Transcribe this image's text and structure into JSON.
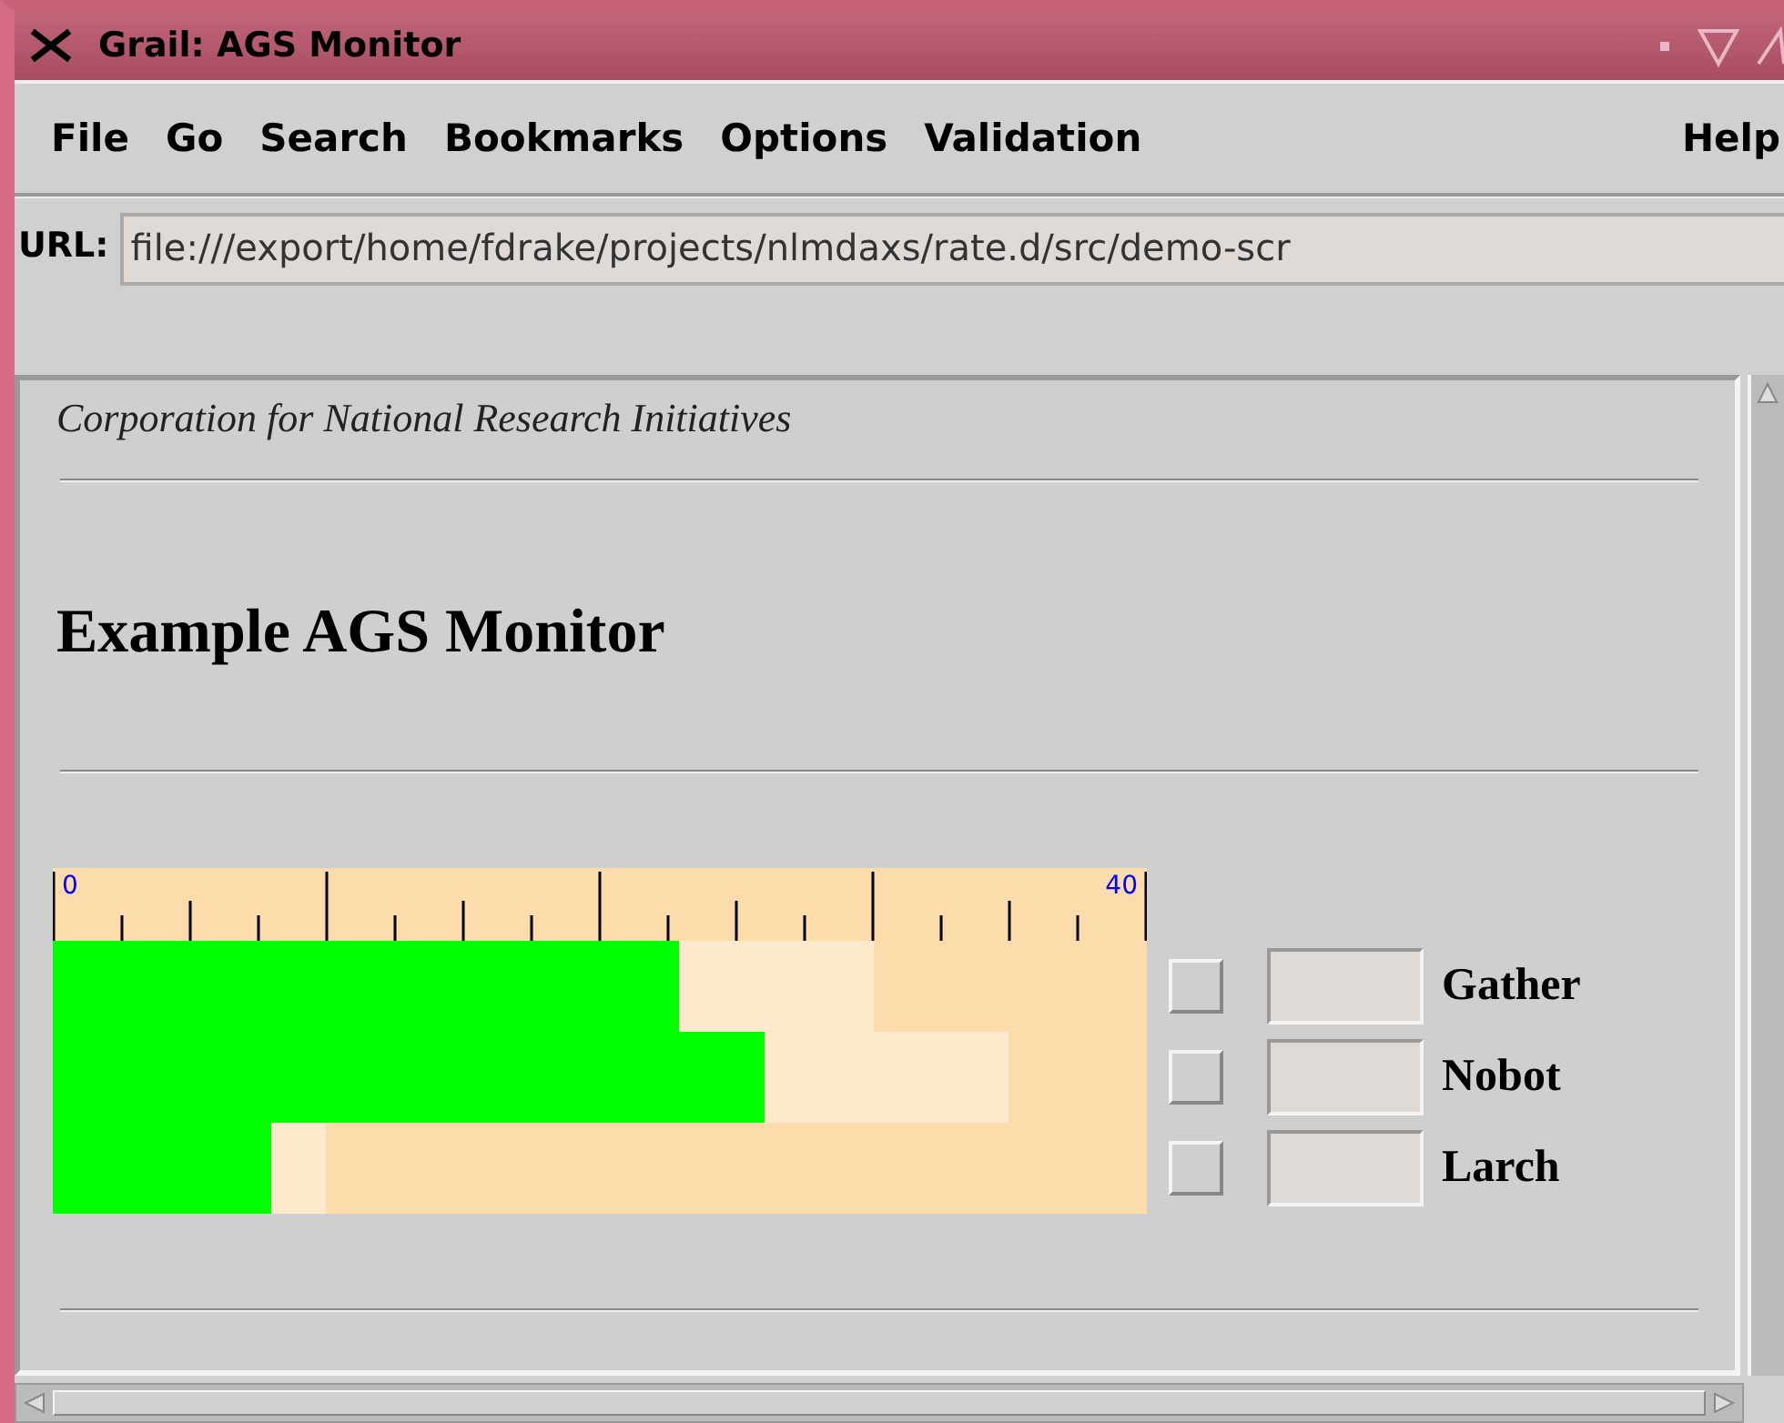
{
  "window": {
    "title": "Grail: AGS Monitor"
  },
  "menu": [
    "File",
    "Go",
    "Search",
    "Bookmarks",
    "Options",
    "Validation"
  ],
  "help_menu": "Help",
  "url": {
    "label": "URL:",
    "value": "file:///export/home/fdrake/projects/nlmdaxs/rate.d/src/demo-scr"
  },
  "page": {
    "organization": "Corporation for National Research Initiatives",
    "heading": "Example AGS Monitor",
    "meter": {
      "scale_min": "0",
      "scale_max": "40",
      "rows": [
        {
          "name": "Gather",
          "level": 0.573,
          "peak": {
            "level": 0.75
          },
          "checked": false
        },
        {
          "name": "Nobot",
          "level": 0.65,
          "peak": {
            "level": 0.873
          },
          "checked": false
        },
        {
          "name": "Larch",
          "level": 0.2,
          "peak": {
            "level": 0.25
          },
          "checked": false
        }
      ]
    }
  }
}
